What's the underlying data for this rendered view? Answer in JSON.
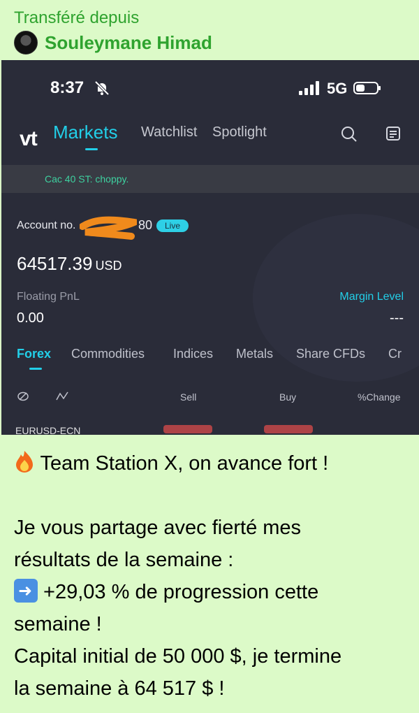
{
  "forward": {
    "label": "Transféré depuis",
    "sender_name": "Souleymane Himad"
  },
  "screenshot": {
    "status_bar": {
      "time": "8:37",
      "network": "5G",
      "icons": [
        "bell-slash-icon",
        "signal-bars-icon",
        "battery-icon"
      ]
    },
    "app": {
      "logo": "vt",
      "tabs": [
        {
          "label": "Markets",
          "active": true
        },
        {
          "label": "Watchlist",
          "active": false
        },
        {
          "label": "Spotlight",
          "active": false
        }
      ],
      "header_icons": [
        "search-icon",
        "news-icon"
      ],
      "ticker": "Cac 40 ST: choppy."
    },
    "account": {
      "label": "Account no.",
      "number_suffix": "80",
      "badge": "Live",
      "balance": "64517.39",
      "currency": "USD",
      "floating_pnl_label": "Floating PnL",
      "floating_pnl_value": "0.00",
      "margin_level_label": "Margin Level",
      "margin_level_value": "---"
    },
    "categories": [
      {
        "label": "Forex",
        "active": true
      },
      {
        "label": "Commodities",
        "active": false
      },
      {
        "label": "Indices",
        "active": false
      },
      {
        "label": "Metals",
        "active": false
      },
      {
        "label": "Share CFDs",
        "active": false
      },
      {
        "label": "Cr",
        "active": false
      }
    ],
    "columns": [
      "Sell",
      "Buy",
      "%Change"
    ],
    "peek_row": "EURUSD-ECN"
  },
  "message": {
    "line1": " Team Station X, on avance fort !",
    "line2": "Je vous partage avec fierté mes",
    "line3": "résultats de la semaine :",
    "line4": " +29,03 % de progression cette",
    "line5": "semaine !",
    "line6": "Capital initial de 50 000 $, je termine",
    "line7": "la semaine à 64 517 $ !"
  },
  "colors": {
    "bubble": "#dcfac8",
    "forward_green": "#2fa32f",
    "app_bg": "#2a2c39",
    "accent": "#22cfe8",
    "ticker_green": "#3ed1a0"
  }
}
